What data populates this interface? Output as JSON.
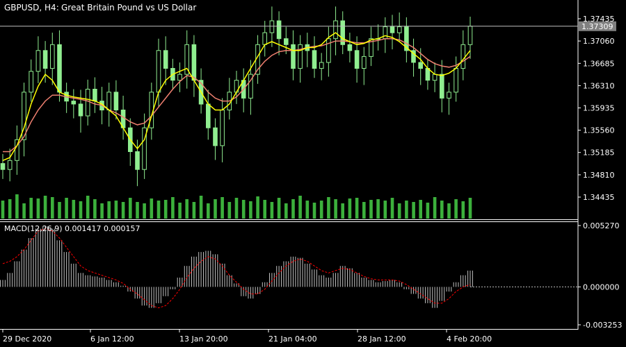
{
  "header": {
    "symbol_timeframe": "GBPUSD, H4:",
    "description": "Great Britain Pound vs US Dollar"
  },
  "macd_header": "MACD(12,26,9) 0.001417 0.000157",
  "colors": {
    "background": "#000000",
    "candles": "#90ee90",
    "volume": "#3cb03c",
    "ma_fast": "#ffff00",
    "ma_slow": "#f08070",
    "macd_histogram": "#c0c0c0",
    "macd_signal": "#ff0000",
    "price_line": "#c0c0c0",
    "current_price_badge": "#808080"
  },
  "chart_data": [
    {
      "type": "candlestick",
      "title": "GBPUSD, H4",
      "ylim": [
        1.3425,
        1.376
      ],
      "yticks": [
        "1.37435",
        "1.37060",
        "1.36685",
        "1.36310",
        "1.35935",
        "1.35560",
        "1.35185",
        "1.34810",
        "1.34435"
      ],
      "current_price": "1.37309",
      "xticks": [
        "29 Dec 2020",
        "6 Jan 12:00",
        "13 Jan 20:00",
        "21 Jan 04:00",
        "28 Jan 12:00",
        "4 Feb 20:00"
      ],
      "close": [
        1.349,
        1.3505,
        1.354,
        1.362,
        1.3655,
        1.369,
        1.366,
        1.37,
        1.362,
        1.3605,
        1.36,
        1.358,
        1.3625,
        1.3605,
        1.359,
        1.362,
        1.359,
        1.356,
        1.352,
        1.349,
        1.356,
        1.362,
        1.369,
        1.366,
        1.364,
        1.365,
        1.37,
        1.364,
        1.36,
        1.356,
        1.353,
        1.359,
        1.362,
        1.364,
        1.361,
        1.365,
        1.37,
        1.372,
        1.374,
        1.371,
        1.37,
        1.366,
        1.37,
        1.369,
        1.366,
        1.367,
        1.371,
        1.374,
        1.37,
        1.369,
        1.366,
        1.368,
        1.371,
        1.371,
        1.373,
        1.372,
        1.373,
        1.369,
        1.367,
        1.366,
        1.364,
        1.365,
        1.361,
        1.362,
        1.366,
        1.37,
        1.3731
      ],
      "ma_fast": [
        1.3505,
        1.351,
        1.353,
        1.356,
        1.36,
        1.363,
        1.365,
        1.364,
        1.362,
        1.3615,
        1.3612,
        1.361,
        1.3608,
        1.3605,
        1.36,
        1.359,
        1.358,
        1.356,
        1.354,
        1.3525,
        1.354,
        1.358,
        1.362,
        1.364,
        1.365,
        1.3655,
        1.366,
        1.364,
        1.362,
        1.36,
        1.359,
        1.359,
        1.36,
        1.362,
        1.364,
        1.366,
        1.368,
        1.37,
        1.3705,
        1.37,
        1.3695,
        1.369,
        1.369,
        1.3695,
        1.3695,
        1.37,
        1.3712,
        1.372,
        1.371,
        1.3705,
        1.37,
        1.3702,
        1.3708,
        1.371,
        1.3715,
        1.3712,
        1.3705,
        1.3695,
        1.3685,
        1.3675,
        1.366,
        1.365,
        1.3648,
        1.3652,
        1.366,
        1.3675,
        1.369
      ],
      "ma_slow": [
        1.352,
        1.352,
        1.353,
        1.3545,
        1.357,
        1.359,
        1.3605,
        1.3615,
        1.3615,
        1.3612,
        1.361,
        1.3608,
        1.3605,
        1.36,
        1.3598,
        1.359,
        1.3585,
        1.3578,
        1.357,
        1.3565,
        1.3568,
        1.358,
        1.3595,
        1.361,
        1.3625,
        1.3638,
        1.3648,
        1.3645,
        1.3635,
        1.362,
        1.361,
        1.3605,
        1.3605,
        1.3612,
        1.3625,
        1.364,
        1.3658,
        1.3672,
        1.3682,
        1.3688,
        1.369,
        1.369,
        1.3692,
        1.3695,
        1.3697,
        1.3698,
        1.3702,
        1.3706,
        1.3706,
        1.3705,
        1.3703,
        1.3703,
        1.3705,
        1.3707,
        1.371,
        1.371,
        1.3708,
        1.3702,
        1.3695,
        1.3685,
        1.3675,
        1.3668,
        1.3664,
        1.3662,
        1.3665,
        1.3672,
        1.368
      ],
      "volume": [
        26,
        28,
        35,
        22,
        30,
        29,
        33,
        31,
        24,
        30,
        27,
        25,
        33,
        28,
        22,
        25,
        26,
        24,
        30,
        24,
        22,
        29,
        26,
        27,
        31,
        23,
        28,
        24,
        33,
        22,
        28,
        31,
        24,
        30,
        27,
        25,
        32,
        27,
        24,
        30,
        22,
        28,
        33,
        26,
        23,
        26,
        31,
        28,
        22,
        29,
        30,
        24,
        27,
        28,
        26,
        30,
        22,
        26,
        24,
        27,
        23,
        31,
        26,
        22,
        28,
        25,
        30
      ]
    },
    {
      "type": "bar",
      "title": "MACD(12,26,9)",
      "values_text": [
        "0.001417",
        "0.000157"
      ],
      "ylim": [
        -0.003253,
        0.00527
      ],
      "yticks": [
        "0.005270",
        "0.000000",
        "-0.003253"
      ],
      "histogram": [
        0.0006,
        0.0012,
        0.0022,
        0.0032,
        0.0042,
        0.005,
        0.0052,
        0.005,
        0.004,
        0.003,
        0.002,
        0.0012,
        0.001,
        0.0009,
        0.0008,
        0.0006,
        0.0004,
        0.0001,
        -0.0004,
        -0.001,
        -0.0016,
        -0.0018,
        -0.0014,
        -0.0008,
        -0.0002,
        0.0008,
        0.0018,
        0.0026,
        0.003,
        0.0031,
        0.0028,
        0.002,
        0.001,
        0.0003,
        -0.0008,
        -0.001,
        -0.0006,
        0.0004,
        0.0012,
        0.0018,
        0.0022,
        0.0026,
        0.0025,
        0.002,
        0.0015,
        0.001,
        0.0008,
        0.0012,
        0.0018,
        0.0016,
        0.0012,
        0.0008,
        0.0006,
        0.0004,
        0.0005,
        0.0006,
        0.0004,
        -0.0002,
        -0.0006,
        -0.001,
        -0.0014,
        -0.0018,
        -0.0012,
        -0.0004,
        0.0004,
        0.001,
        0.0014
      ],
      "signal": [
        0.002,
        0.0022,
        0.0026,
        0.0032,
        0.004,
        0.0048,
        0.005,
        0.0048,
        0.0042,
        0.0034,
        0.0026,
        0.0018,
        0.0014,
        0.0012,
        0.001,
        0.0008,
        0.0006,
        0.0003,
        -0.0002,
        -0.0006,
        -0.0011,
        -0.0016,
        -0.0018,
        -0.0016,
        -0.001,
        -0.0002,
        0.0008,
        0.0016,
        0.0022,
        0.0026,
        0.0024,
        0.0018,
        0.001,
        0.0004,
        -0.0002,
        -0.0006,
        -0.0006,
        -0.0002,
        0.0005,
        0.0012,
        0.0018,
        0.0022,
        0.0024,
        0.0022,
        0.0018,
        0.0014,
        0.0012,
        0.0014,
        0.0016,
        0.0015,
        0.0012,
        0.0009,
        0.0007,
        0.0006,
        0.0006,
        0.0006,
        0.0005,
        0.0002,
        -0.0002,
        -0.0006,
        -0.001,
        -0.0014,
        -0.0014,
        -0.001,
        -0.0004,
        0.0,
        0.0002
      ]
    }
  ]
}
